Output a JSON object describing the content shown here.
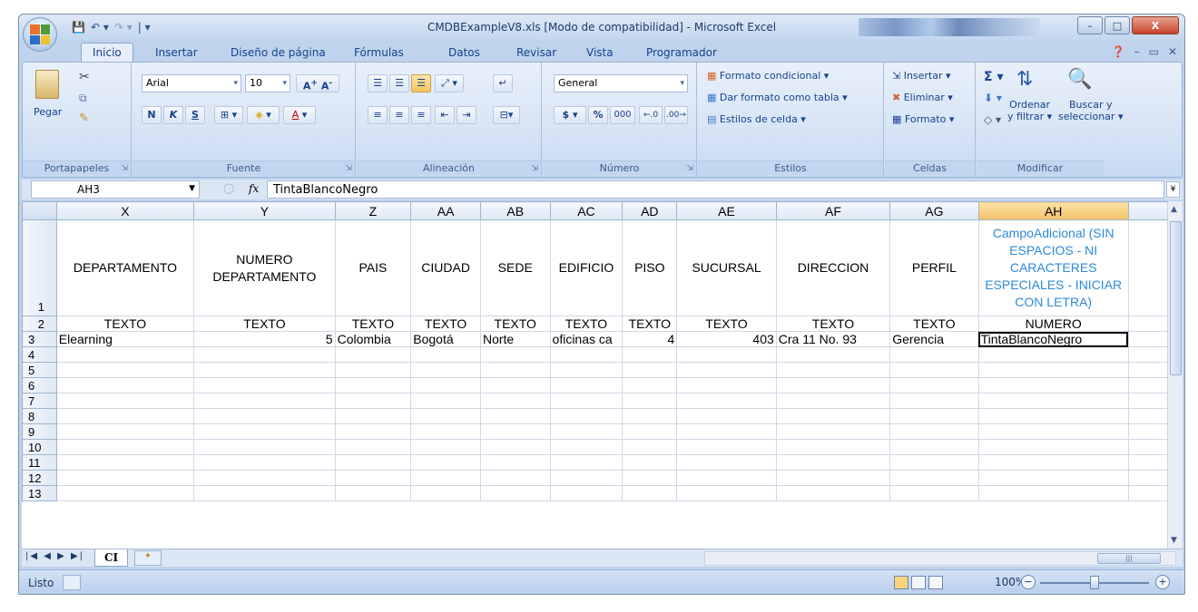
{
  "window": {
    "title": "CMDBExampleV8.xls  [Modo de compatibilidad] - Microsoft Excel",
    "min": "–",
    "max": "□",
    "close": "X"
  },
  "tabs": [
    "Inicio",
    "Insertar",
    "Diseño de página",
    "Fórmulas",
    "Datos",
    "Revisar",
    "Vista",
    "Programador"
  ],
  "ribbon": {
    "portapapeles": {
      "paste": "Pegar",
      "label": "Portapapeles"
    },
    "fuente": {
      "font": "Arial",
      "size": "10",
      "bold": "N",
      "italic": "K",
      "underline": "S",
      "label": "Fuente"
    },
    "alineacion": {
      "label": "Alineación"
    },
    "numero": {
      "format": "General",
      "currency": "$",
      "percent": "%",
      "thousands": "000",
      "label": "Número"
    },
    "estilos": {
      "conditional": "Formato condicional",
      "table": "Dar formato como tabla",
      "cell_styles": "Estilos de celda",
      "label": "Estilos"
    },
    "celdas": {
      "insert": "Insertar",
      "delete": "Eliminar",
      "format": "Formato",
      "label": "Celdas"
    },
    "modificar": {
      "sort": "Ordenar",
      "sort2": "y filtrar",
      "find": "Buscar y",
      "find2": "seleccionar",
      "label": "Modificar",
      "sigma": "Σ"
    }
  },
  "formula_bar": {
    "name_box": "AH3",
    "fx": "fx",
    "value": "TintaBlancoNegro"
  },
  "grid": {
    "columns": [
      "X",
      "Y",
      "Z",
      "AA",
      "AB",
      "AC",
      "AD",
      "AE",
      "AF",
      "AG",
      "AH"
    ],
    "active_column": "AH",
    "row_numbers": [
      "1",
      "2",
      "3",
      "4",
      "5",
      "6",
      "7",
      "8",
      "9",
      "10",
      "11",
      "12",
      "13"
    ],
    "row1": [
      "DEPARTAMENTO",
      "NUMERO DEPARTAMENTO",
      "PAIS",
      "CIUDAD",
      "SEDE",
      "EDIFICIO",
      "PISO",
      "SUCURSAL",
      "DIRECCION",
      "PERFIL",
      "CampoAdicional (SIN ESPACIOS - NI CARACTERES ESPECIALES - INICIAR CON LETRA)"
    ],
    "row2": [
      "TEXTO",
      "TEXTO",
      "TEXTO",
      "TEXTO",
      "TEXTO",
      "TEXTO",
      "TEXTO",
      "TEXTO",
      "TEXTO",
      "TEXTO",
      "NUMERO"
    ],
    "row3": [
      "Elearning",
      "5",
      "Colombia",
      "Bogotá",
      "Norte",
      "oficinas ca",
      "4",
      "403",
      "Cra 11 No. 93",
      "Gerencia",
      "TintaBlancoNegro"
    ],
    "selected_cell": "AH3"
  },
  "sheet": {
    "tab": "CI"
  },
  "status": {
    "text": "Listo",
    "zoom": "100%",
    "minus": "−",
    "plus": "+"
  }
}
